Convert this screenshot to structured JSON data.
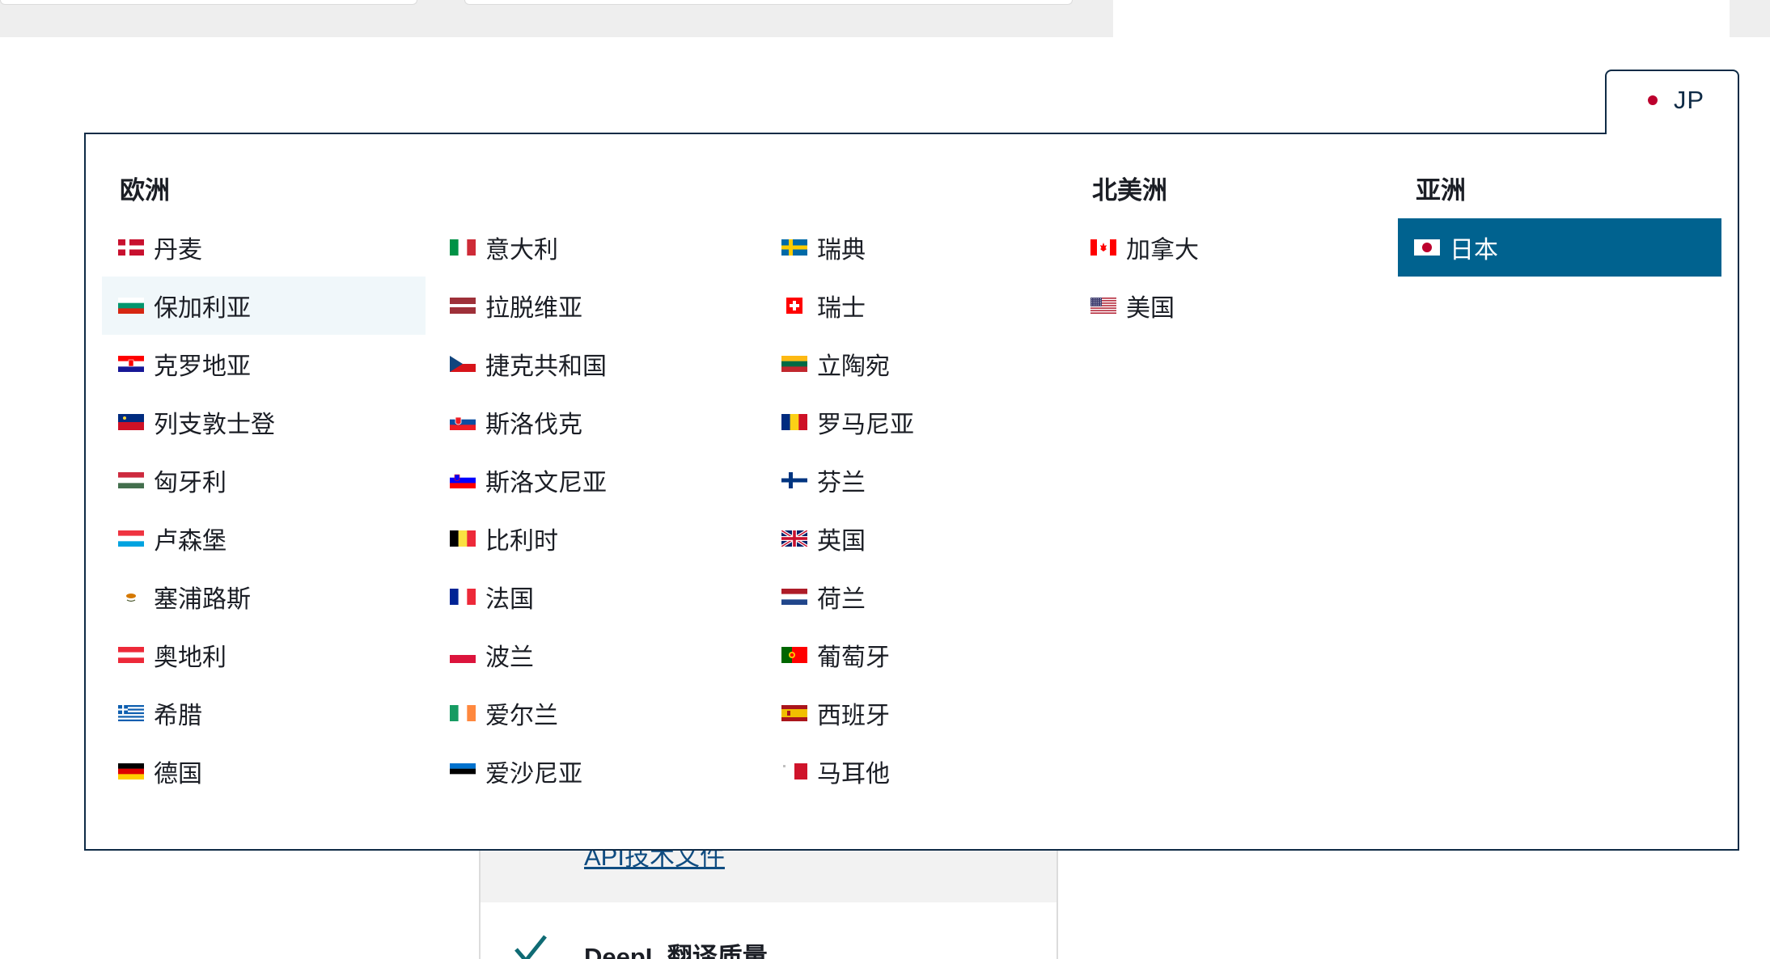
{
  "background": {
    "api_link": "API技术文件",
    "quality_heading": "DeepL 翻译质量"
  },
  "country_selector": {
    "current_code": "JP",
    "current_flag": "jp-flag-icon"
  },
  "regions": {
    "europe": {
      "title": "欧洲",
      "columns": [
        [
          {
            "label": "丹麦",
            "flag": "dk"
          },
          {
            "label": "保加利亚",
            "flag": "bg"
          },
          {
            "label": "克罗地亚",
            "flag": "hr"
          },
          {
            "label": "列支敦士登",
            "flag": "li"
          },
          {
            "label": "匈牙利",
            "flag": "hu"
          },
          {
            "label": "卢森堡",
            "flag": "lu"
          },
          {
            "label": "塞浦路斯",
            "flag": "cy"
          },
          {
            "label": "奥地利",
            "flag": "at"
          },
          {
            "label": "希腊",
            "flag": "gr"
          },
          {
            "label": "德国",
            "flag": "de"
          }
        ],
        [
          {
            "label": "意大利",
            "flag": "it"
          },
          {
            "label": "拉脱维亚",
            "flag": "lv"
          },
          {
            "label": "捷克共和国",
            "flag": "cz"
          },
          {
            "label": "斯洛伐克",
            "flag": "sk"
          },
          {
            "label": "斯洛文尼亚",
            "flag": "si"
          },
          {
            "label": "比利时",
            "flag": "be"
          },
          {
            "label": "法国",
            "flag": "fr"
          },
          {
            "label": "波兰",
            "flag": "pl"
          },
          {
            "label": "爱尔兰",
            "flag": "ie"
          },
          {
            "label": "爱沙尼亚",
            "flag": "ee"
          }
        ],
        [
          {
            "label": "瑞典",
            "flag": "se"
          },
          {
            "label": "瑞士",
            "flag": "ch"
          },
          {
            "label": "立陶宛",
            "flag": "lt"
          },
          {
            "label": "罗马尼亚",
            "flag": "ro"
          },
          {
            "label": "芬兰",
            "flag": "fi"
          },
          {
            "label": "英国",
            "flag": "gb"
          },
          {
            "label": "荷兰",
            "flag": "nl"
          },
          {
            "label": "葡萄牙",
            "flag": "pt"
          },
          {
            "label": "西班牙",
            "flag": "es"
          },
          {
            "label": "马耳他",
            "flag": "mt"
          }
        ]
      ]
    },
    "north_america": {
      "title": "北美洲",
      "items": [
        {
          "label": "加拿大",
          "flag": "ca"
        },
        {
          "label": "美国",
          "flag": "us"
        }
      ]
    },
    "asia": {
      "title": "亚洲",
      "items": [
        {
          "label": "日本",
          "flag": "jp"
        }
      ]
    }
  },
  "state": {
    "hovered": "保加利亚",
    "selected": "日本"
  },
  "colors": {
    "selected_bg": "#00628f",
    "hover_bg": "#f0f7fa",
    "border": "#0f2b46"
  }
}
